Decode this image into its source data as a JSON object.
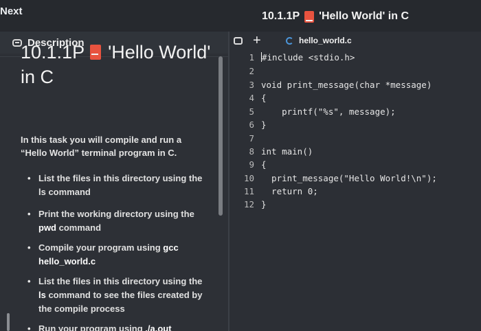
{
  "nav": {
    "next_label": "Next"
  },
  "header": {
    "task_code": "10.1.1P",
    "task_name": "'Hello World' in C"
  },
  "description_tab": {
    "label": "Description"
  },
  "task": {
    "title_code": "10.1.1P",
    "title_name": "'Hello World' in C",
    "intro": "In this task you will compile and run a “Hello World” terminal program in C.",
    "steps": [
      {
        "pre": "List the files in this directory using the ls command",
        "bold": "",
        "post": ""
      },
      {
        "pre": "Print the working directory using the ",
        "bold": "pwd",
        "post": " command"
      },
      {
        "pre": "Compile your program using ",
        "bold": "gcc hello_world.c",
        "post": ""
      },
      {
        "pre": "List the files in this directory using the ",
        "bold": "ls",
        "post": " command to see the files created by the compile process"
      },
      {
        "pre": "Run your program using ",
        "bold": "./a.out",
        "post": ""
      }
    ]
  },
  "editor": {
    "new_file_symbol": "+",
    "file_name": "hello_world.c",
    "lines": [
      {
        "n": "1",
        "text": "#include <stdio.h>"
      },
      {
        "n": "2",
        "text": ""
      },
      {
        "n": "3",
        "text": "void print_message(char *message)"
      },
      {
        "n": "4",
        "text": "{"
      },
      {
        "n": "5",
        "text": "    printf(\"%s\", message);"
      },
      {
        "n": "6",
        "text": "}"
      },
      {
        "n": "7",
        "text": ""
      },
      {
        "n": "8",
        "text": "int main()"
      },
      {
        "n": "9",
        "text": "{"
      },
      {
        "n": "10",
        "text": "  print_message(\"Hello World!\\n\");"
      },
      {
        "n": "11",
        "text": "  return 0;"
      },
      {
        "n": "12",
        "text": "}"
      }
    ]
  },
  "colors": {
    "background": "#2a2d33",
    "book_icon": "#e8533f",
    "c_file_icon": "#4b95d9",
    "text": "#e8e8e8"
  }
}
